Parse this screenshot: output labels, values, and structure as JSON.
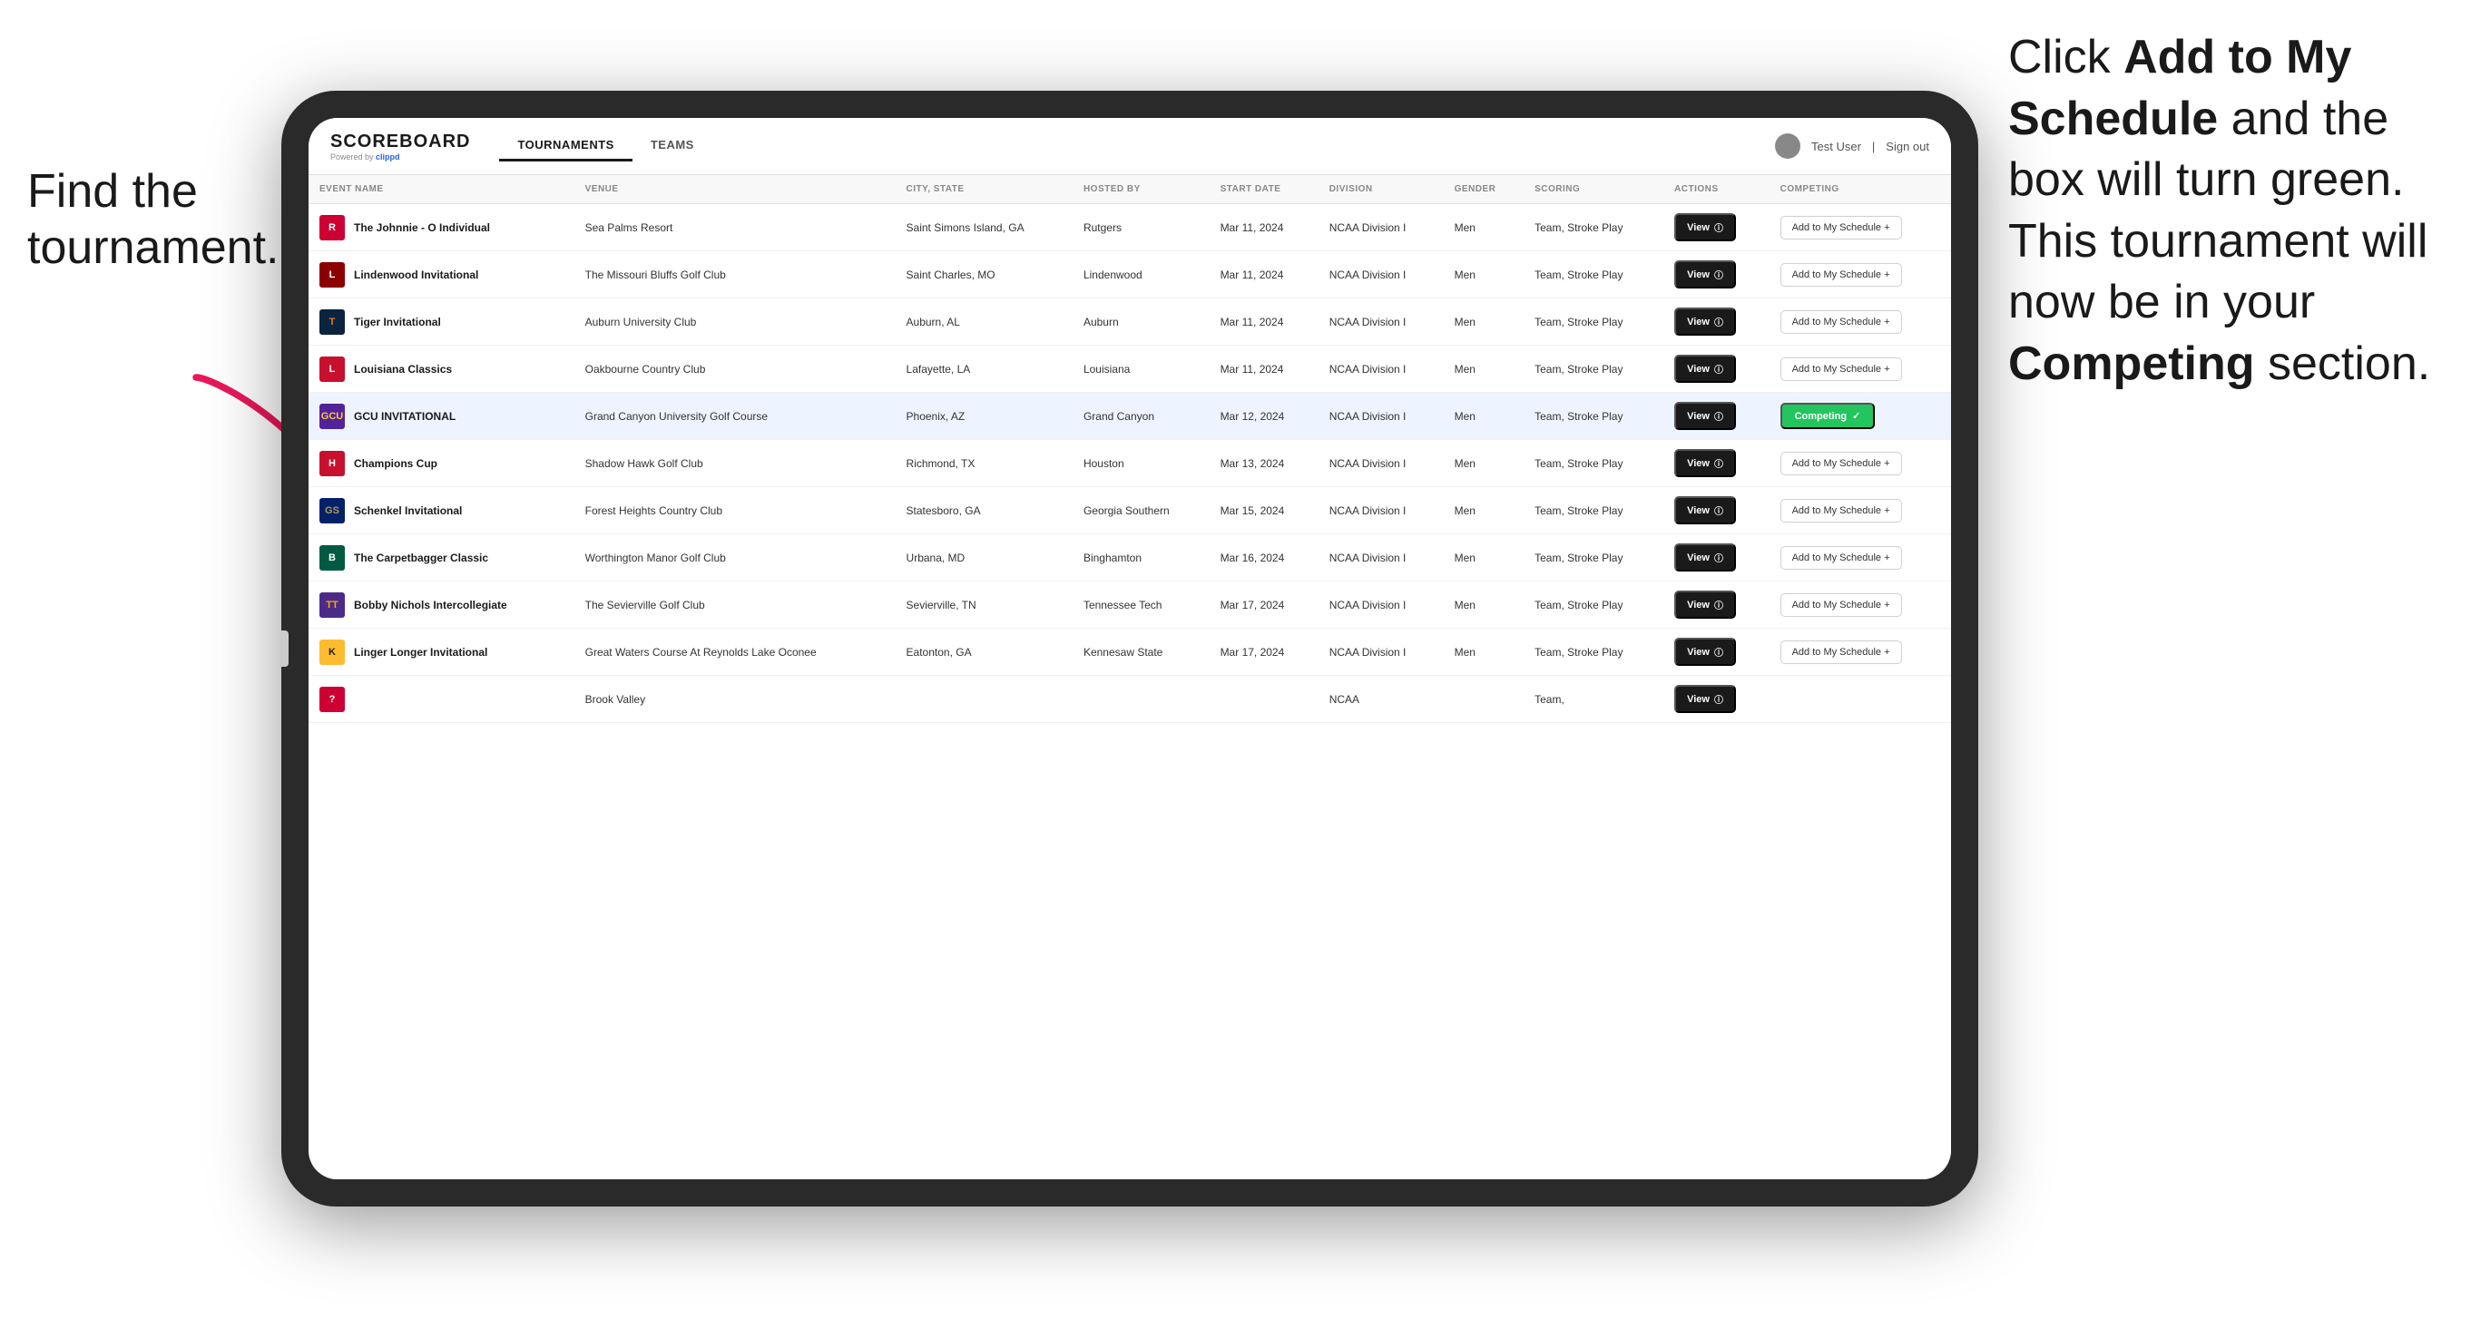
{
  "annotations": {
    "left": "Find the\ntournament.",
    "right_part1": "Click ",
    "right_bold1": "Add to My\nSchedule",
    "right_part2": " and the\nbox will turn green.\nThis tournament\nwill now be in\nyour ",
    "right_bold2": "Competing",
    "right_part3": "\nsection."
  },
  "app": {
    "logo": "SCOREBOARD",
    "powered_by": "Powered by",
    "brand": "clippd",
    "nav": [
      "TOURNAMENTS",
      "TEAMS"
    ],
    "active_nav": "TOURNAMENTS",
    "user": "Test User",
    "sign_out": "Sign out"
  },
  "table": {
    "columns": [
      "EVENT NAME",
      "VENUE",
      "CITY, STATE",
      "HOSTED BY",
      "START DATE",
      "DIVISION",
      "GENDER",
      "SCORING",
      "ACTIONS",
      "COMPETING"
    ],
    "rows": [
      {
        "logo_text": "R",
        "logo_class": "logo-rutgers",
        "event": "The Johnnie - O Individual",
        "venue": "Sea Palms Resort",
        "city_state": "Saint Simons Island, GA",
        "hosted_by": "Rutgers",
        "start_date": "Mar 11, 2024",
        "division": "NCAA Division I",
        "gender": "Men",
        "scoring": "Team, Stroke Play",
        "action": "View",
        "competing": "Add to My Schedule +",
        "is_competing": false,
        "highlighted": false
      },
      {
        "logo_text": "L",
        "logo_class": "logo-lindenwood",
        "event": "Lindenwood Invitational",
        "venue": "The Missouri Bluffs Golf Club",
        "city_state": "Saint Charles, MO",
        "hosted_by": "Lindenwood",
        "start_date": "Mar 11, 2024",
        "division": "NCAA Division I",
        "gender": "Men",
        "scoring": "Team, Stroke Play",
        "action": "View",
        "competing": "Add to My Schedule +",
        "is_competing": false,
        "highlighted": false
      },
      {
        "logo_text": "T",
        "logo_class": "logo-auburn",
        "event": "Tiger Invitational",
        "venue": "Auburn University Club",
        "city_state": "Auburn, AL",
        "hosted_by": "Auburn",
        "start_date": "Mar 11, 2024",
        "division": "NCAA Division I",
        "gender": "Men",
        "scoring": "Team, Stroke Play",
        "action": "View",
        "competing": "Add to My Schedule +",
        "is_competing": false,
        "highlighted": false
      },
      {
        "logo_text": "L",
        "logo_class": "logo-louisiana",
        "event": "Louisiana Classics",
        "venue": "Oakbourne Country Club",
        "city_state": "Lafayette, LA",
        "hosted_by": "Louisiana",
        "start_date": "Mar 11, 2024",
        "division": "NCAA Division I",
        "gender": "Men",
        "scoring": "Team, Stroke Play",
        "action": "View",
        "competing": "Add to My Schedule +",
        "is_competing": false,
        "highlighted": false
      },
      {
        "logo_text": "GCU",
        "logo_class": "logo-gcu",
        "event": "GCU INVITATIONAL",
        "venue": "Grand Canyon University Golf Course",
        "city_state": "Phoenix, AZ",
        "hosted_by": "Grand Canyon",
        "start_date": "Mar 12, 2024",
        "division": "NCAA Division I",
        "gender": "Men",
        "scoring": "Team, Stroke Play",
        "action": "View",
        "competing": "Competing ✓",
        "is_competing": true,
        "highlighted": true
      },
      {
        "logo_text": "H",
        "logo_class": "logo-houston",
        "event": "Champions Cup",
        "venue": "Shadow Hawk Golf Club",
        "city_state": "Richmond, TX",
        "hosted_by": "Houston",
        "start_date": "Mar 13, 2024",
        "division": "NCAA Division I",
        "gender": "Men",
        "scoring": "Team, Stroke Play",
        "action": "View",
        "competing": "Add to My Schedule +",
        "is_competing": false,
        "highlighted": false
      },
      {
        "logo_text": "GS",
        "logo_class": "logo-georgia-southern",
        "event": "Schenkel Invitational",
        "venue": "Forest Heights Country Club",
        "city_state": "Statesboro, GA",
        "hosted_by": "Georgia Southern",
        "start_date": "Mar 15, 2024",
        "division": "NCAA Division I",
        "gender": "Men",
        "scoring": "Team, Stroke Play",
        "action": "View",
        "competing": "Add to My Schedule +",
        "is_competing": false,
        "highlighted": false
      },
      {
        "logo_text": "B",
        "logo_class": "logo-binghamton",
        "event": "The Carpetbagger Classic",
        "venue": "Worthington Manor Golf Club",
        "city_state": "Urbana, MD",
        "hosted_by": "Binghamton",
        "start_date": "Mar 16, 2024",
        "division": "NCAA Division I",
        "gender": "Men",
        "scoring": "Team, Stroke Play",
        "action": "View",
        "competing": "Add to My Schedule +",
        "is_competing": false,
        "highlighted": false
      },
      {
        "logo_text": "TT",
        "logo_class": "logo-tennessee-tech",
        "event": "Bobby Nichols Intercollegiate",
        "venue": "The Sevierville Golf Club",
        "city_state": "Sevierville, TN",
        "hosted_by": "Tennessee Tech",
        "start_date": "Mar 17, 2024",
        "division": "NCAA Division I",
        "gender": "Men",
        "scoring": "Team, Stroke Play",
        "action": "View",
        "competing": "Add to My Schedule +",
        "is_competing": false,
        "highlighted": false
      },
      {
        "logo_text": "K",
        "logo_class": "logo-kennesaw",
        "event": "Linger Longer Invitational",
        "venue": "Great Waters Course At Reynolds Lake Oconee",
        "city_state": "Eatonton, GA",
        "hosted_by": "Kennesaw State",
        "start_date": "Mar 17, 2024",
        "division": "NCAA Division I",
        "gender": "Men",
        "scoring": "Team, Stroke Play",
        "action": "View",
        "competing": "Add to My Schedule +",
        "is_competing": false,
        "highlighted": false
      },
      {
        "logo_text": "?",
        "logo_class": "logo-rutgers",
        "event": "",
        "venue": "Brook Valley",
        "city_state": "",
        "hosted_by": "",
        "start_date": "",
        "division": "NCAA",
        "gender": "",
        "scoring": "Team,",
        "action": "View",
        "competing": "",
        "is_competing": false,
        "highlighted": false
      }
    ]
  }
}
